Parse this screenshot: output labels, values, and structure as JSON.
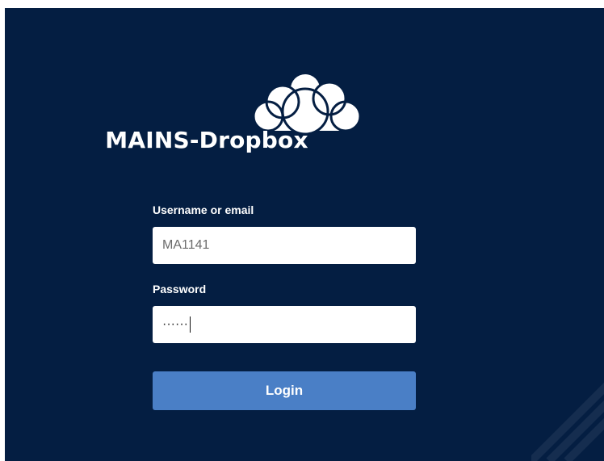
{
  "brand": {
    "name": "MAINS-Dropbox",
    "logo_icon": "cloud-icon"
  },
  "form": {
    "username_label": "Username or email",
    "username_value": "MA1141",
    "password_label": "Password",
    "password_value": "······",
    "login_label": "Login"
  },
  "colors": {
    "background": "#041e42",
    "button": "#4a7fc6",
    "input_bg": "#ffffff",
    "text_light": "#ffffff"
  }
}
